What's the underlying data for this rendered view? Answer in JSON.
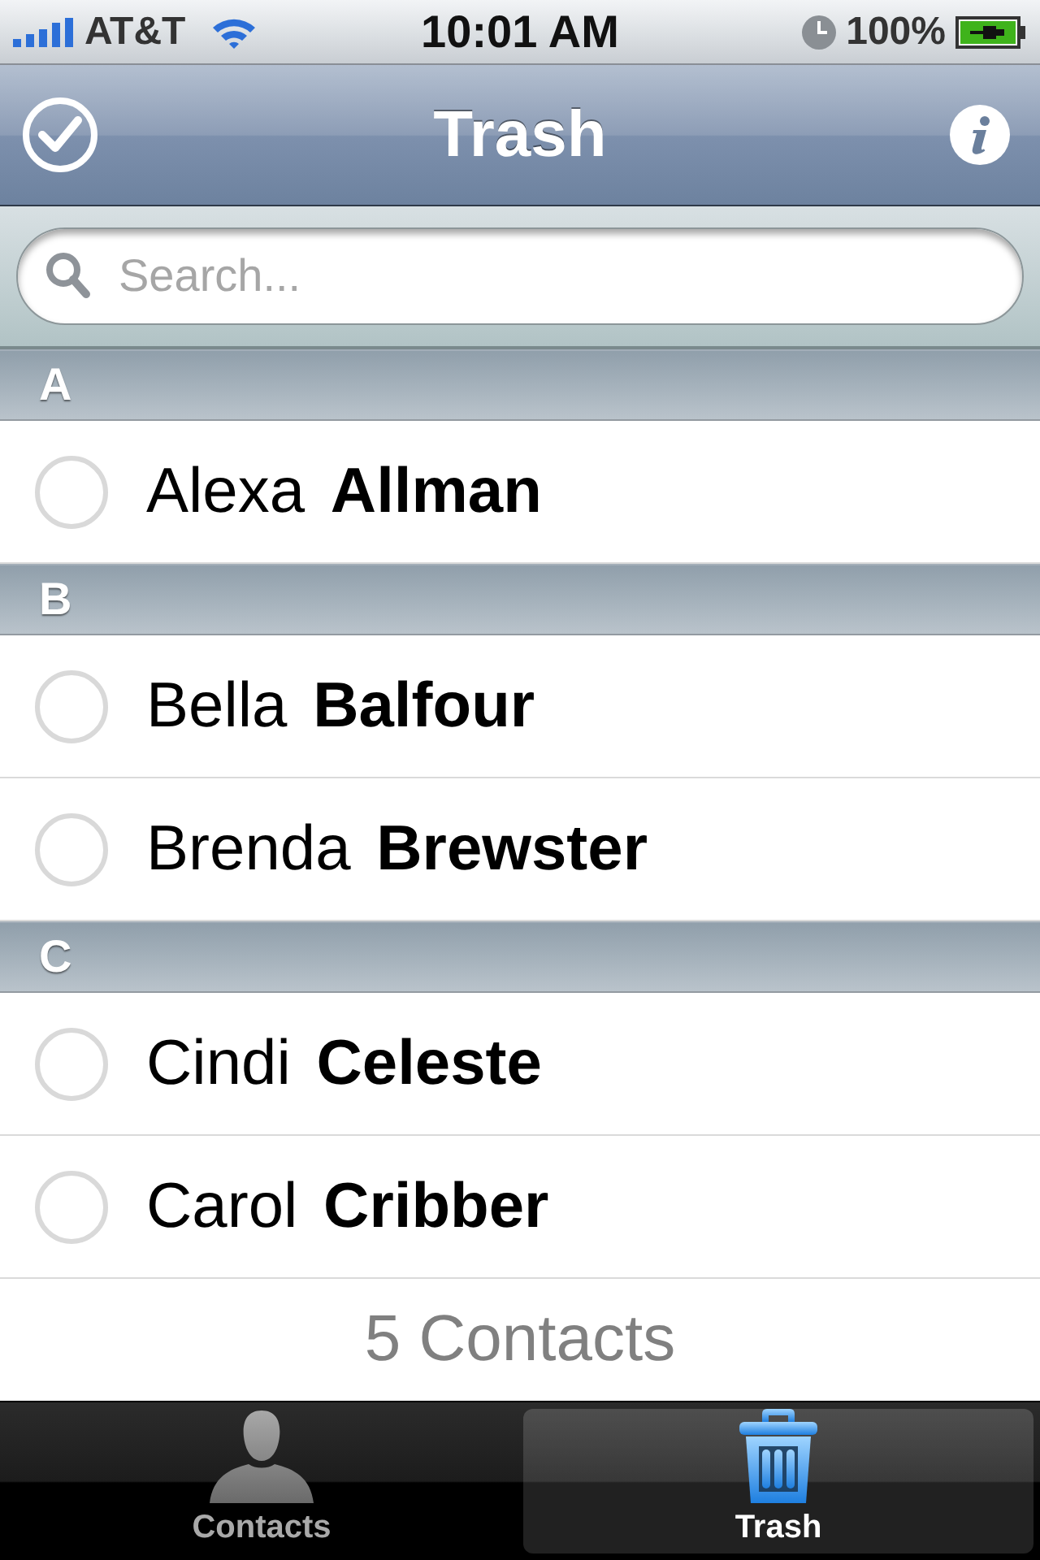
{
  "status_bar": {
    "carrier": "AT&T",
    "time": "10:01 AM",
    "battery": "100%"
  },
  "nav_bar": {
    "title": "Trash"
  },
  "search": {
    "placeholder": "Search..."
  },
  "sections": [
    {
      "letter": "A",
      "contacts": [
        {
          "name": "Alexa **Allman**",
          "checked": false
        }
      ]
    },
    {
      "letter": "B",
      "contacts": [
        {
          "name": "Bella **Balfour**",
          "checked": false
        },
        {
          "name": "Brenda **Brewster**",
          "checked": false
        }
      ]
    },
    {
      "letter": "C",
      "contacts": [
        {
          "name": "Cindi **Celeste**",
          "checked": false
        },
        {
          "name": "Carol **Cribber**",
          "checked": false
        }
      ]
    }
  ],
  "footer": "5 Contacts",
  "tab_bar": {
    "tabs": [
      {
        "label": "Contacts",
        "kind": "person",
        "selected": false
      },
      {
        "label": "Trash",
        "kind": "trash",
        "selected": true
      }
    ]
  }
}
